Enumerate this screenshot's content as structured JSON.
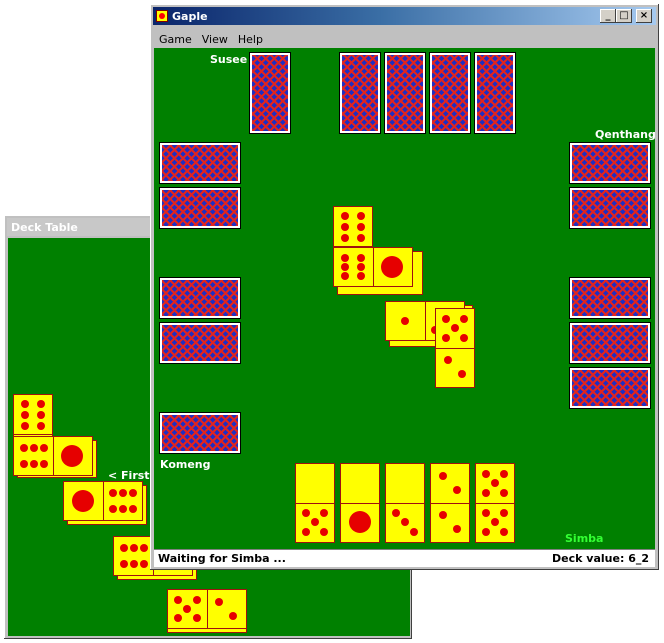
{
  "deck_window": {
    "title": "Deck Table",
    "first_label": "< First o"
  },
  "main_window": {
    "title": "Gaple",
    "controls": {
      "minimize": "_",
      "maximize": "□",
      "close": "×"
    },
    "menu": [
      "Game",
      "View",
      "Help"
    ],
    "players": {
      "top": "Susee",
      "right": "Qenthang",
      "left": "Komeng",
      "bottom": "Simba"
    },
    "status": {
      "message": "Waiting for Simba ...",
      "deck_value": "Deck value: 6_2"
    }
  },
  "colors": {
    "felt": "#008000",
    "domino_face": "#ffff00",
    "pip": "#e60000",
    "active_player": "#33ff33",
    "title_active": "#0a246a"
  },
  "played_dominoes": [
    {
      "a": 6,
      "b": 6
    },
    {
      "a": 6,
      "b": 1
    },
    {
      "a": 1,
      "b": 3
    },
    {
      "a": 3,
      "b": 5
    },
    {
      "a": 5,
      "b": 2
    }
  ],
  "hand_dominoes": [
    {
      "a": 0,
      "b": 5
    },
    {
      "a": 0,
      "b": 1
    },
    {
      "a": 0,
      "b": 3
    },
    {
      "a": 2,
      "b": 2
    },
    {
      "a": 5,
      "b": 5
    }
  ]
}
